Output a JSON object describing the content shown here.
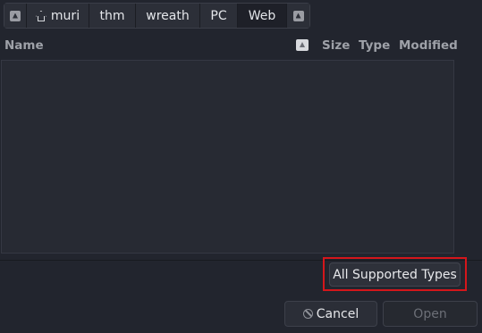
{
  "breadcrumb": {
    "back_icon": "arrow-left-icon",
    "home_icon": "home-icon",
    "items": [
      "muri",
      "thm",
      "wreath",
      "PC",
      "Web"
    ],
    "active_index": 4,
    "forward_icon": "arrow-right-icon"
  },
  "columns": {
    "name": "Name",
    "size": "Size",
    "type": "Type",
    "modified": "Modified",
    "sort_icon": "sort-indicator-icon"
  },
  "filter": {
    "selected": "All Supported Types",
    "highlight_color": "#d4161b"
  },
  "buttons": {
    "cancel": "Cancel",
    "cancel_icon": "cancel-icon",
    "open": "Open"
  }
}
